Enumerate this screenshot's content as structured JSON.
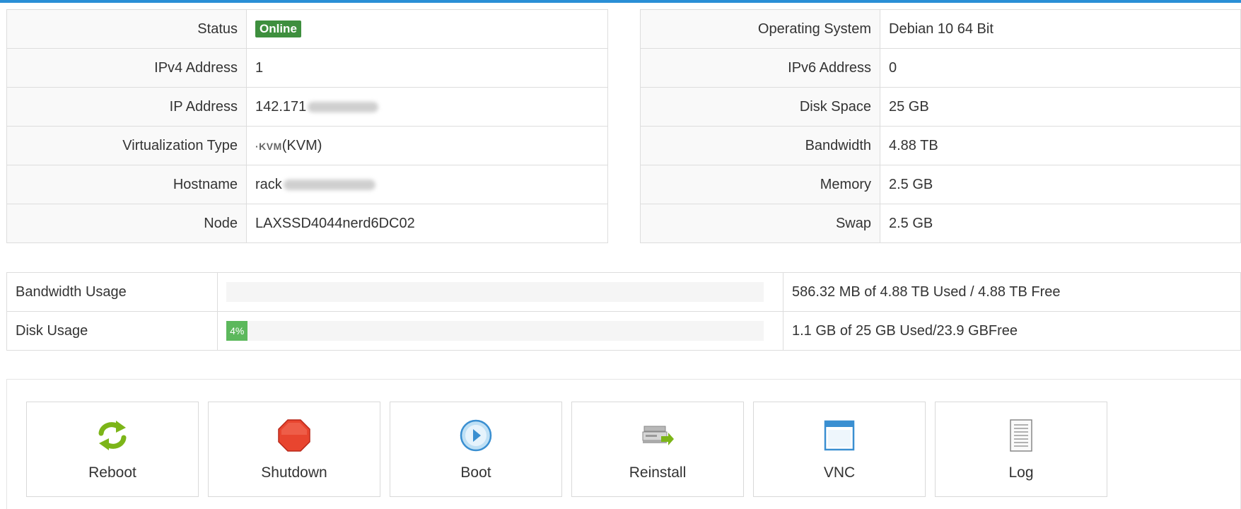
{
  "colors": {
    "accent": "#2a8fd6",
    "online_badge": "#3e8f3e",
    "progress": "#5cb85c"
  },
  "info_left": [
    {
      "label": "Status",
      "value": "Online",
      "value_type": "badge"
    },
    {
      "label": "IPv4 Address",
      "value": "1"
    },
    {
      "label": "IP Address",
      "value": "142.171",
      "redacted": true
    },
    {
      "label": "Virtualization Type",
      "value": "(KVM)",
      "logo_text": "KVM"
    },
    {
      "label": "Hostname",
      "value": "rack",
      "redacted": true
    },
    {
      "label": "Node",
      "value": "LAXSSD4044nerd6DC02"
    }
  ],
  "info_right": [
    {
      "label": "Operating System",
      "value": "Debian 10 64 Bit"
    },
    {
      "label": "IPv6 Address",
      "value": "0"
    },
    {
      "label": "Disk Space",
      "value": "25 GB"
    },
    {
      "label": "Bandwidth",
      "value": "4.88 TB"
    },
    {
      "label": "Memory",
      "value": "2.5 GB"
    },
    {
      "label": "Swap",
      "value": "2.5 GB"
    }
  ],
  "usage": {
    "bandwidth": {
      "label": "Bandwidth Usage",
      "percent": 0,
      "bar_text": "",
      "summary": "586.32 MB of 4.88 TB Used / 4.88 TB Free"
    },
    "disk": {
      "label": "Disk Usage",
      "percent": 4,
      "bar_text": "4%",
      "summary": "1.1 GB of 25 GB Used/23.9 GBFree"
    }
  },
  "actions": [
    {
      "label": "Reboot",
      "icon": "reboot-icon"
    },
    {
      "label": "Shutdown",
      "icon": "shutdown-icon"
    },
    {
      "label": "Boot",
      "icon": "boot-icon"
    },
    {
      "label": "Reinstall",
      "icon": "reinstall-icon"
    },
    {
      "label": "VNC",
      "icon": "vnc-icon"
    },
    {
      "label": "Log",
      "icon": "log-icon"
    }
  ]
}
